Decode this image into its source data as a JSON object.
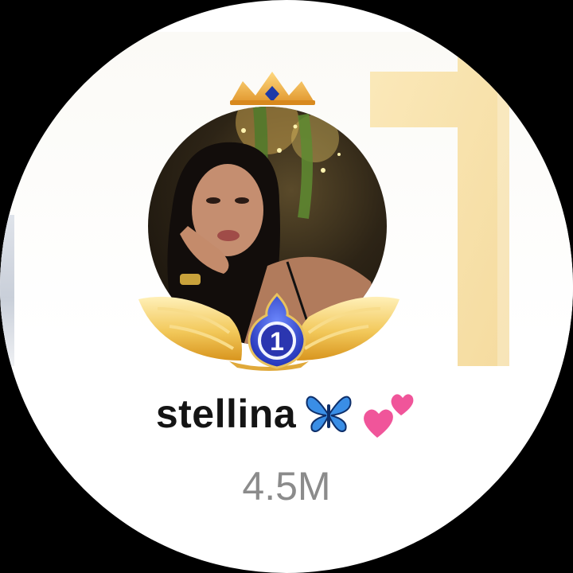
{
  "profile": {
    "username": "stellina",
    "username_emojis": [
      "blue-butterfly-emoji",
      "two-hearts-emoji"
    ],
    "follower_count": "4.5M",
    "rank": "1"
  },
  "decorations": {
    "background_rank_numeral": "1",
    "crown": "gold-crown-icon",
    "frame": "gold-wings-icon"
  },
  "colors": {
    "frame_background": "#000000",
    "gold": "#f2cf74",
    "badge_blue": "#3b4fd8",
    "follower_gray": "#8b8b8b",
    "username": "#141414"
  }
}
